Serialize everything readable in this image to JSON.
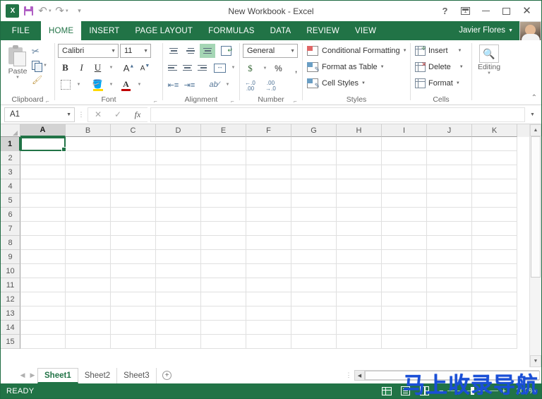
{
  "window": {
    "title": "New Workbook - Excel",
    "app_logo": "excel-logo",
    "quick_access": [
      {
        "name": "save",
        "icon": "save-icon"
      },
      {
        "name": "undo",
        "icon": "undo-icon"
      },
      {
        "name": "redo",
        "icon": "redo-icon"
      },
      {
        "name": "customize",
        "icon": "customize-qat-icon"
      }
    ],
    "controls": [
      {
        "name": "help",
        "glyph": "?"
      },
      {
        "name": "ribbon-display-options",
        "glyph": "ribbon"
      },
      {
        "name": "minimize",
        "glyph": "minimize"
      },
      {
        "name": "restore",
        "glyph": "restore"
      },
      {
        "name": "close",
        "glyph": "close"
      }
    ]
  },
  "ribbon": {
    "file_tab": "FILE",
    "tabs": [
      {
        "label": "HOME",
        "active": true
      },
      {
        "label": "INSERT",
        "active": false
      },
      {
        "label": "PAGE LAYOUT",
        "active": false
      },
      {
        "label": "FORMULAS",
        "active": false
      },
      {
        "label": "DATA",
        "active": false
      },
      {
        "label": "REVIEW",
        "active": false
      },
      {
        "label": "VIEW",
        "active": false
      }
    ],
    "account": {
      "name": "Javier Flores",
      "avatar": "user-avatar"
    },
    "groups": {
      "clipboard": {
        "label": "Clipboard",
        "paste_label": "Paste",
        "cut": "Cut",
        "copy": "Copy",
        "format_painter": "Format Painter"
      },
      "font": {
        "label": "Font",
        "font_name": "Calibri",
        "font_size": "11",
        "bold": "B",
        "italic": "I",
        "underline": "U",
        "grow_font": "A",
        "shrink_font": "A",
        "borders": "Borders",
        "fill_color": "Fill Color",
        "font_color": "Font Color"
      },
      "alignment": {
        "label": "Alignment",
        "top_align": "Top Align",
        "middle_align": "Middle Align",
        "bottom_align": "Bottom Align",
        "wrap_text": "Wrap Text",
        "align_left": "Align Left",
        "center": "Center",
        "align_right": "Align Right",
        "merge_center": "Merge & Center",
        "decrease_indent": "Decrease Indent",
        "increase_indent": "Increase Indent",
        "orientation": "Orientation"
      },
      "number": {
        "label": "Number",
        "format": "General",
        "accounting": "$",
        "percent": "%",
        "comma": ",",
        "increase_decimal": "Increase Decimal",
        "decrease_decimal": "Decrease Decimal"
      },
      "styles": {
        "label": "Styles",
        "items": [
          {
            "label": "Conditional Formatting",
            "icon": "conditional-formatting-icon"
          },
          {
            "label": "Format as Table",
            "icon": "format-as-table-icon"
          },
          {
            "label": "Cell Styles",
            "icon": "cell-styles-icon"
          }
        ]
      },
      "cells": {
        "label": "Cells",
        "items": [
          {
            "label": "Insert",
            "icon": "insert-cells-icon"
          },
          {
            "label": "Delete",
            "icon": "delete-cells-icon"
          },
          {
            "label": "Format",
            "icon": "format-cells-icon"
          }
        ]
      },
      "editing": {
        "label": "Editing",
        "icon": "find-select-icon"
      }
    },
    "collapse": "collapse-ribbon-icon"
  },
  "formula_bar": {
    "name_box": "A1",
    "cancel": "cancel-icon",
    "enter": "enter-icon",
    "insert_function": "fx",
    "formula_value": "",
    "expand": "expand-formula-bar-icon"
  },
  "grid": {
    "columns": [
      "A",
      "B",
      "C",
      "D",
      "E",
      "F",
      "G",
      "H",
      "I",
      "J",
      "K"
    ],
    "rows": [
      "1",
      "2",
      "3",
      "4",
      "5",
      "6",
      "7",
      "8",
      "9",
      "10",
      "11",
      "12",
      "13",
      "14",
      "15"
    ],
    "active_cell": {
      "column": "A",
      "row": "1"
    }
  },
  "sheet_tabs": {
    "nav_prev": "previous-sheet-icon",
    "nav_next": "next-sheet-icon",
    "tabs": [
      {
        "label": "Sheet1",
        "active": true
      },
      {
        "label": "Sheet2",
        "active": false
      },
      {
        "label": "Sheet3",
        "active": false
      }
    ],
    "add_sheet": "+"
  },
  "status_bar": {
    "status": "READY",
    "views": [
      {
        "name": "normal-view",
        "label": "Normal"
      },
      {
        "name": "page-layout-view",
        "label": "Page Layout"
      },
      {
        "name": "page-break-preview",
        "label": "Page Break Preview"
      }
    ],
    "zoom_out": "−",
    "zoom_in": "+",
    "zoom_level": "100%"
  },
  "watermark": {
    "text": "马上收录导航",
    "color": "#1a4fd6"
  },
  "theme": {
    "accent": "#217346",
    "ribbon_bg": "#ffffff",
    "status_bg": "#217346"
  }
}
